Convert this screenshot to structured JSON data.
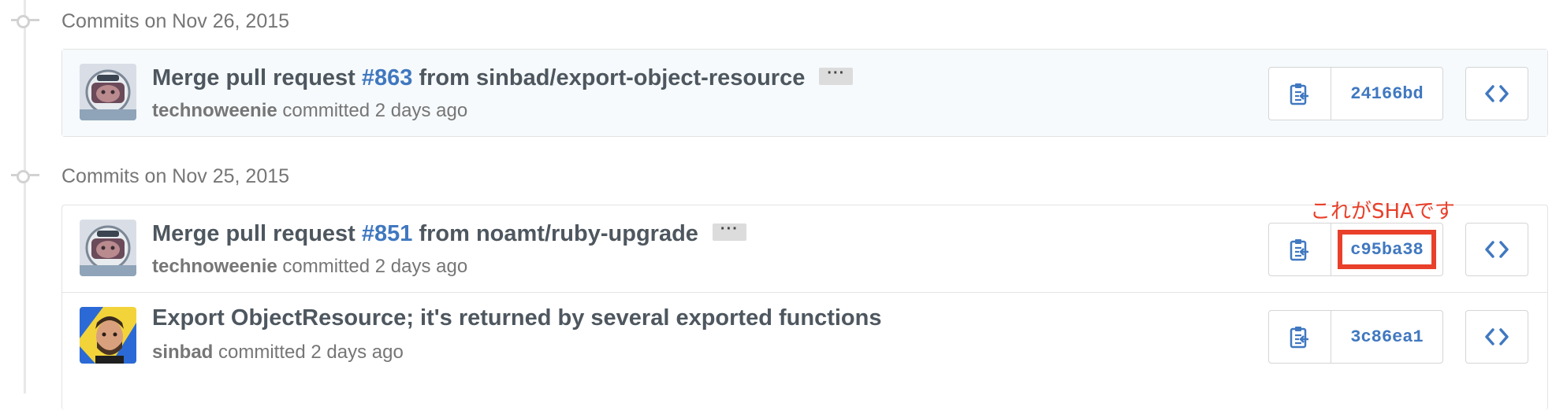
{
  "groups": [
    {
      "title": "Commits on Nov 26, 2015",
      "commits": [
        {
          "title_prefix": "Merge pull request ",
          "pr_number": "#863",
          "title_suffix": " from sinbad/export-object-resource",
          "ellipsis": "···",
          "author": "technoweenie",
          "meta": "committed 2 days ago",
          "sha": "24166bd",
          "avatar": "helmet-avatar"
        }
      ]
    },
    {
      "title": "Commits on Nov 25, 2015",
      "commits": [
        {
          "title_prefix": "Merge pull request ",
          "pr_number": "#851",
          "title_suffix": " from noamt/ruby-upgrade",
          "ellipsis": "···",
          "author": "technoweenie",
          "meta": "committed 2 days ago",
          "sha": "c95ba38",
          "avatar": "helmet-avatar"
        },
        {
          "title": "Export ObjectResource; it's returned by several exported functions",
          "author": "sinbad",
          "meta": "committed 2 days ago",
          "sha": "3c86ea1",
          "avatar": "bearded-man-avatar"
        }
      ]
    }
  ],
  "annotation": {
    "label": "これがSHAです",
    "color": "#e8402a"
  },
  "icons": {
    "copy": "clipboard-icon",
    "browse": "code-brackets-icon",
    "timeline": "commit-node-icon"
  },
  "colors": {
    "link": "#4078c0",
    "title": "#4e575f",
    "muted": "#767676",
    "highlight_row": "#f6fafc"
  }
}
